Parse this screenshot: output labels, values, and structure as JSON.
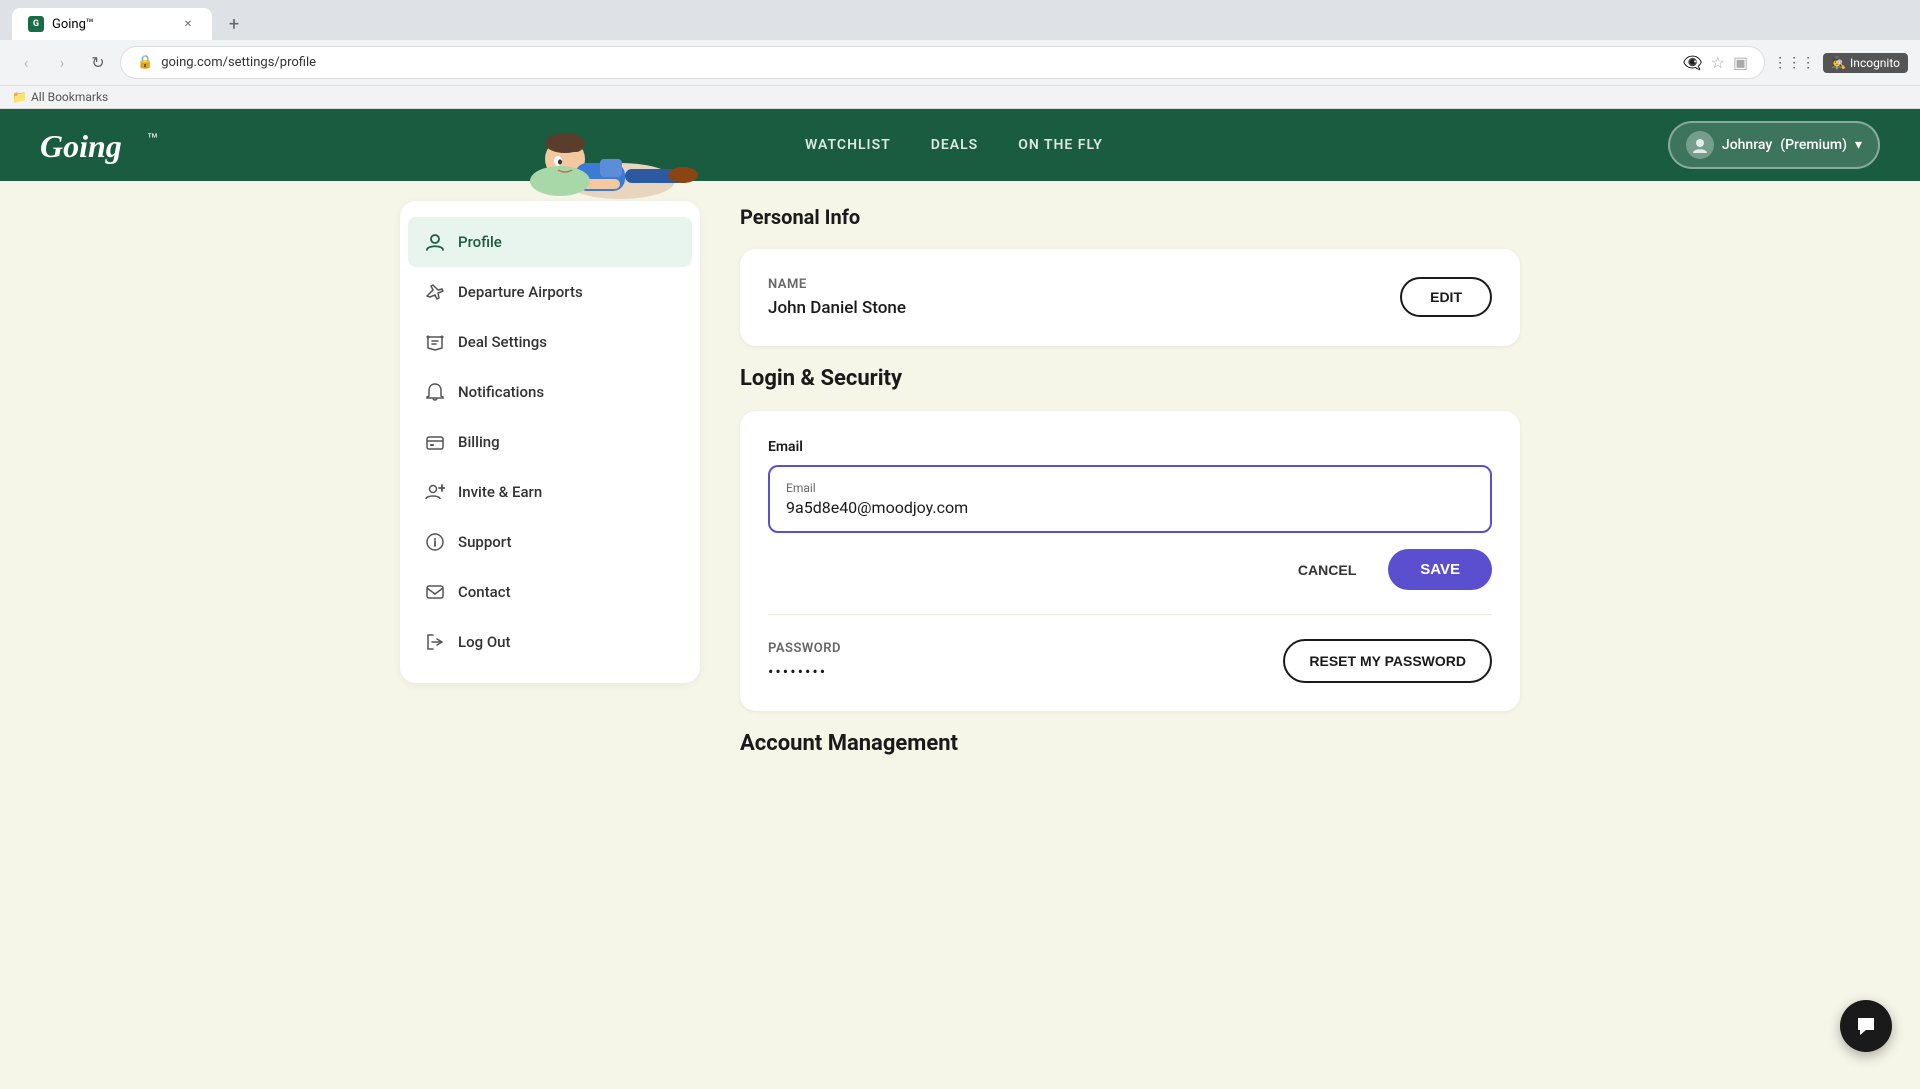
{
  "browser": {
    "tab_title": "Going™",
    "tab_favicon": "G",
    "url": "going.com/settings/profile",
    "incognito_label": "Incognito",
    "bookmarks_label": "All Bookmarks"
  },
  "header": {
    "logo": "Going",
    "logo_tm": "™",
    "nav": [
      {
        "id": "watchlist",
        "label": "WATCHLIST"
      },
      {
        "id": "deals",
        "label": "DEALS"
      },
      {
        "id": "on-the-fly",
        "label": "ON THE FLY"
      }
    ],
    "user_name": "Johnray",
    "user_plan": "(Premium)",
    "user_chevron": "▾"
  },
  "sidebar": {
    "items": [
      {
        "id": "profile",
        "label": "Profile",
        "active": true,
        "icon": "person"
      },
      {
        "id": "departure-airports",
        "label": "Departure Airports",
        "active": false,
        "icon": "plane"
      },
      {
        "id": "deal-settings",
        "label": "Deal Settings",
        "active": false,
        "icon": "tag"
      },
      {
        "id": "notifications",
        "label": "Notifications",
        "active": false,
        "icon": "bell"
      },
      {
        "id": "billing",
        "label": "Billing",
        "active": false,
        "icon": "card"
      },
      {
        "id": "invite-earn",
        "label": "Invite & Earn",
        "active": false,
        "icon": "person-plus"
      },
      {
        "id": "support",
        "label": "Support",
        "active": false,
        "icon": "info"
      },
      {
        "id": "contact",
        "label": "Contact",
        "active": false,
        "icon": "contact"
      },
      {
        "id": "log-out",
        "label": "Log Out",
        "active": false,
        "icon": "logout"
      }
    ]
  },
  "main": {
    "personal_info_title": "Personal Info",
    "name_label": "Name",
    "name_value": "John Daniel Stone",
    "edit_label": "EDIT",
    "login_security_title": "Login & Security",
    "email_section_label": "Email",
    "email_field_label": "Email",
    "email_value": "9a5d8e40@moodjoy.com",
    "cancel_label": "CANCEL",
    "save_label": "SAVE",
    "password_label": "Password",
    "password_value": "••••••••",
    "reset_password_label": "RESET MY PASSWORD",
    "account_management_title": "Account Management"
  }
}
